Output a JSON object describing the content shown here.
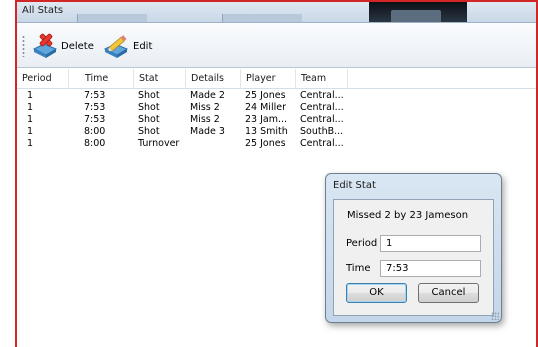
{
  "window": {
    "title": "All Stats"
  },
  "toolbar": {
    "delete_label": "Delete",
    "edit_label": "Edit"
  },
  "table": {
    "columns": [
      "Period",
      "Time",
      "Stat",
      "Details",
      "Player",
      "Team"
    ],
    "rows": [
      [
        "1",
        "7:53",
        "Shot",
        "Made 2",
        "25 Jones",
        "Central..."
      ],
      [
        "1",
        "7:53",
        "Shot",
        "Miss 2",
        "24 Miller",
        "Central..."
      ],
      [
        "1",
        "7:53",
        "Shot",
        "Miss 2",
        "23 Jam...",
        "Central..."
      ],
      [
        "1",
        "8:00",
        "Shot",
        "Made 3",
        "13 Smith",
        "SouthB..."
      ],
      [
        "1",
        "8:00",
        "Turnover",
        "",
        "25 Jones",
        "Central..."
      ]
    ]
  },
  "dialog": {
    "title": "Edit Stat",
    "description": "Missed 2 by 23 Jameson",
    "period_label": "Period",
    "period_value": "1",
    "time_label": "Time",
    "time_value": "7:53",
    "ok_label": "OK",
    "cancel_label": "Cancel"
  },
  "colors": {
    "window_border": "#d22525",
    "dialog_bg": "#d9e6f3"
  }
}
